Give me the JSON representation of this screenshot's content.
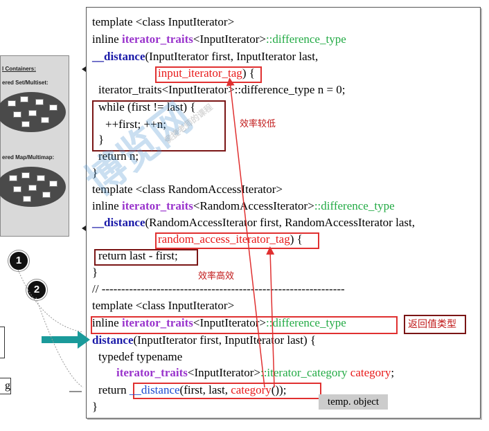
{
  "panel": {
    "title": "l Containers:",
    "set_label": "ered Set/Multiset:",
    "map_label": "ered Map/Multimap:",
    "fragment": "g"
  },
  "markers": {
    "one": "1",
    "two": "2"
  },
  "code": {
    "l1": "template <class InputIterator>",
    "l2_pre": "inline ",
    "l2_traits": "iterator_traits",
    "l2_mid": "<InputIterator>",
    "l2_diff": "::difference_type",
    "l3_func": "__distance",
    "l3_args": "(InputIterator first, InputIterator last,",
    "l4_tag": "input_iterator_tag",
    "l4_brace": ") {",
    "l5": "iterator_traits<InputIterator>::difference_type n = 0;",
    "l6": "while (first != last) {",
    "l7": "++first; ++n;",
    "l8": "}",
    "l9": "return n;",
    "l10": "}",
    "l11": "template <class RandomAccessIterator>",
    "l12_pre": "inline ",
    "l12_traits": "iterator_traits",
    "l12_mid": "<RandomAccessIterator>",
    "l12_diff": "::difference_type",
    "l13_func": "__distance",
    "l13_args": "(RandomAccessIterator first, RandomAccessIterator last,",
    "l14_tag": "random_access_iterator_tag",
    "l14_brace": ") {",
    "l15": "return last - first;",
    "l16": "}",
    "l17": "// --------------------------------------------------------------",
    "l18": "template <class InputIterator>",
    "l19_pre": "inline ",
    "l19_traits": "iterator_traits",
    "l19_mid": "<InputIterator>",
    "l19_diff": "::difference_type",
    "l20_func": "distance",
    "l20_args": "(InputIterator first, InputIterator last) {",
    "l21": "typedef typename",
    "l22_traits": "iterator_traits",
    "l22_mid": "<InputIterator>",
    "l22_cat": "::iterator_category",
    "l22_name": "category",
    "l22_end": ";",
    "l23_pre": "return",
    "l23_func": "__distance",
    "l23_args": "(first, last, ",
    "l23_cat": "category",
    "l23_end": "());",
    "l24": "}"
  },
  "notes": {
    "low": "效率较低",
    "high": "效率高效",
    "return_type": "返回值类型",
    "temp": "temp. object"
  },
  "watermark": {
    "main": "博览网",
    "sub": "侯捷老师的课程"
  },
  "colors": {
    "keyword_purple": "#9933cc",
    "func_blue": "#1a1aa8",
    "type_green": "#22aa44",
    "red": "#e81919",
    "arrow_teal": "#1a9a9a"
  }
}
